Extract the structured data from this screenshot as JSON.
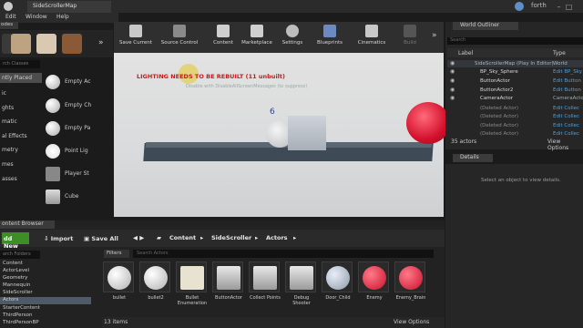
{
  "titlebar": {
    "tab": "SideScrollerMap",
    "user": "forth"
  },
  "menu": [
    "Edit",
    "Window",
    "Help"
  ],
  "modes": {
    "header": "odes",
    "search_placeholder": "rch Classes",
    "categories": [
      "ntly Placed",
      "ic",
      "ghts",
      "matic",
      "al Effects",
      "metry",
      "mes",
      "asses"
    ],
    "items": [
      "Empty Ac",
      "Empty Ch",
      "Empty Pa",
      "Point Lig",
      "Player St",
      "Cube"
    ]
  },
  "toolbar": [
    "Save Current",
    "Source Control",
    "Content",
    "Marketplace",
    "Settings",
    "Blueprints",
    "Cinematics",
    "Build"
  ],
  "viewport": {
    "warning": "LIGHTING NEEDS TO BE REBUILT (11 unbuilt)",
    "subwarning": "Disable with DisableAllScreenMessages  (to suppress)",
    "counter": "6"
  },
  "outliner": {
    "tab": "World Outliner",
    "search_placeholder": "Search",
    "col_label": "Label",
    "col_type": "Type",
    "rows": [
      {
        "name": "SideScrollerMap (Play In Editor)",
        "type": "World"
      },
      {
        "name": "BP_Sky_Sphere",
        "type": "Edit BP_Sky"
      },
      {
        "name": "ButtonActor",
        "type": "Edit Button"
      },
      {
        "name": "ButtonActor2",
        "type": "Edit Button"
      },
      {
        "name": "CameraActor",
        "type": "CameraActor"
      },
      {
        "name": "(Deleted Actor)",
        "type": "Edit Collec"
      },
      {
        "name": "(Deleted Actor)",
        "type": "Edit Collec"
      },
      {
        "name": "(Deleted Actor)",
        "type": "Edit Collec"
      },
      {
        "name": "(Deleted Actor)",
        "type": "Edit Collec"
      }
    ],
    "count": "35 actors",
    "view_options": "View Options"
  },
  "details": {
    "tab": "Details",
    "empty_message": "Select an object to view details."
  },
  "content_browser": {
    "tab": "ontent Browser",
    "add_new": "dd New",
    "import": "Import",
    "save_all": "Save All",
    "breadcrumbs": [
      "Content",
      "SideScroller",
      "Actors"
    ],
    "folder_search": "arch Folders",
    "tree": [
      "Content",
      "ActorLevel",
      "Geometry",
      "Mannequin",
      "SideScroller",
      "Actors",
      "StarterContent",
      "ThirdPerson",
      "ThirdPersonBP"
    ],
    "filters": "Filters",
    "asset_search": "Search Actors",
    "assets": [
      "bullet",
      "bullet2",
      "Bullet Enumeration",
      "ButtonActor",
      "Collect Points",
      "Debug Shooter",
      "Door_Child",
      "Enemy",
      "Enemy_Brain"
    ],
    "item_count": "13 items",
    "view_options": "View Options"
  },
  "colors": {
    "accent_green": "#3e8e28",
    "warning_red": "#d01616",
    "type_link": "#4aa0e0"
  }
}
